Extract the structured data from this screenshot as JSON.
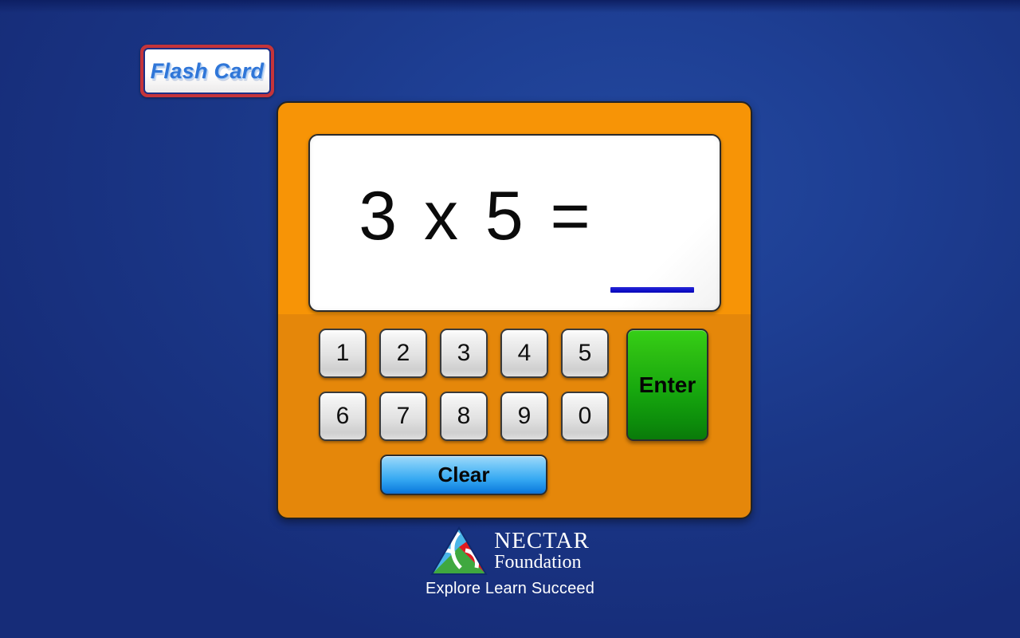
{
  "app": {
    "badge_label": "Flash Card"
  },
  "display": {
    "equation": "3 x 5 =",
    "operand_left": "3",
    "operator": "x",
    "operand_right": "5",
    "equals": "=",
    "answer_value": "",
    "answer_blank_icon": "answer-blank-line"
  },
  "keypad": {
    "row1": [
      "1",
      "2",
      "3",
      "4",
      "5"
    ],
    "row2": [
      "6",
      "7",
      "8",
      "9",
      "0"
    ],
    "enter_label": "Enter",
    "clear_label": "Clear"
  },
  "footer": {
    "logo_icon": "nectar-triangle-logo",
    "org_name": "NECTAR",
    "org_suffix": "Foundation",
    "tagline": "Explore Learn Succeed"
  },
  "colors": {
    "background_dark": "#162c78",
    "background_light": "#23499f",
    "panel_orange": "#f79406",
    "panel_orange_dark": "#e5870a",
    "enter_green": "#2cbd12",
    "clear_blue": "#35a8f2",
    "answer_line_blue": "#1414cf",
    "badge_red": "#c5343a",
    "badge_text_blue": "#2f76d8",
    "logo_blue": "#4ab5e8",
    "logo_green": "#3fa83f",
    "logo_red": "#e01b20"
  }
}
